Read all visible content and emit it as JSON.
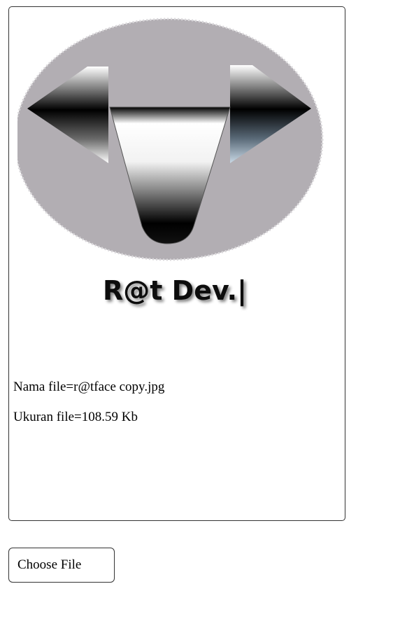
{
  "preview": {
    "image_alt": "r@tface logo",
    "logo_text": "R@t Dev.|",
    "file_name_text": "Nama file=r@tface copy.jpg",
    "file_size_text": "Ukuran file=108.59 Kb"
  },
  "upload": {
    "button_label": "Choose File"
  },
  "colors": {
    "logo_background": "#b2aeb3",
    "border": "#333333"
  }
}
